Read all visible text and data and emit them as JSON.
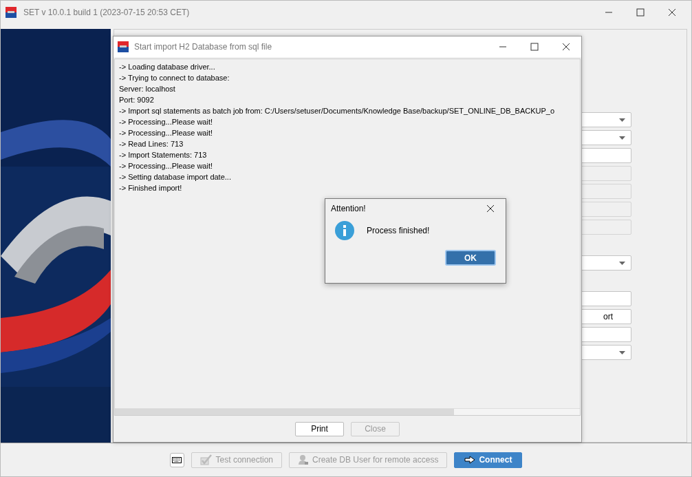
{
  "window": {
    "title": "SET v 10.0.1 build 1 (2023-07-15 20:53 CET)"
  },
  "field_groups": [
    [
      {
        "kind": "dropdown"
      },
      {
        "kind": "dropdown"
      },
      {
        "kind": "text"
      },
      {
        "kind": "disabled"
      },
      {
        "kind": "disabled"
      },
      {
        "kind": "disabled"
      },
      {
        "kind": "disabled"
      }
    ],
    [
      {
        "kind": "dropdown"
      }
    ],
    [
      {
        "kind": "text"
      },
      {
        "kind": "text",
        "value": "ort"
      },
      {
        "kind": "text"
      },
      {
        "kind": "dropdown"
      }
    ]
  ],
  "import_dialog": {
    "title": "Start import H2 Database from sql file",
    "log": [
      "-> Loading database driver...",
      "-> Trying to connect to database:",
      "Server: localhost",
      "Port: 9092",
      "-> Import sql statements as batch job from: C:/Users/setuser/Documents/Knowledge Base/backup/SET_ONLINE_DB_BACKUP_o",
      "-> Processing...Please wait!",
      "-> Processing...Please wait!",
      "-> Read Lines: 713",
      "-> Import Statements: 713",
      "-> Processing...Please wait!",
      "-> Setting database import date...",
      "-> Finished import!"
    ],
    "buttons": [
      {
        "label": "Print",
        "disabled": false
      },
      {
        "label": "Close",
        "disabled": true
      }
    ]
  },
  "alert": {
    "title": "Attention!",
    "message": "Process finished!",
    "button": "OK"
  },
  "toolbar": [
    {
      "kind": "keyboard",
      "disabled": false
    },
    {
      "kind": "test",
      "label": "Test connection",
      "disabled": true
    },
    {
      "kind": "user",
      "label": "Create DB User for remote access",
      "disabled": true
    },
    {
      "kind": "connect",
      "label": "Connect",
      "disabled": false
    }
  ]
}
